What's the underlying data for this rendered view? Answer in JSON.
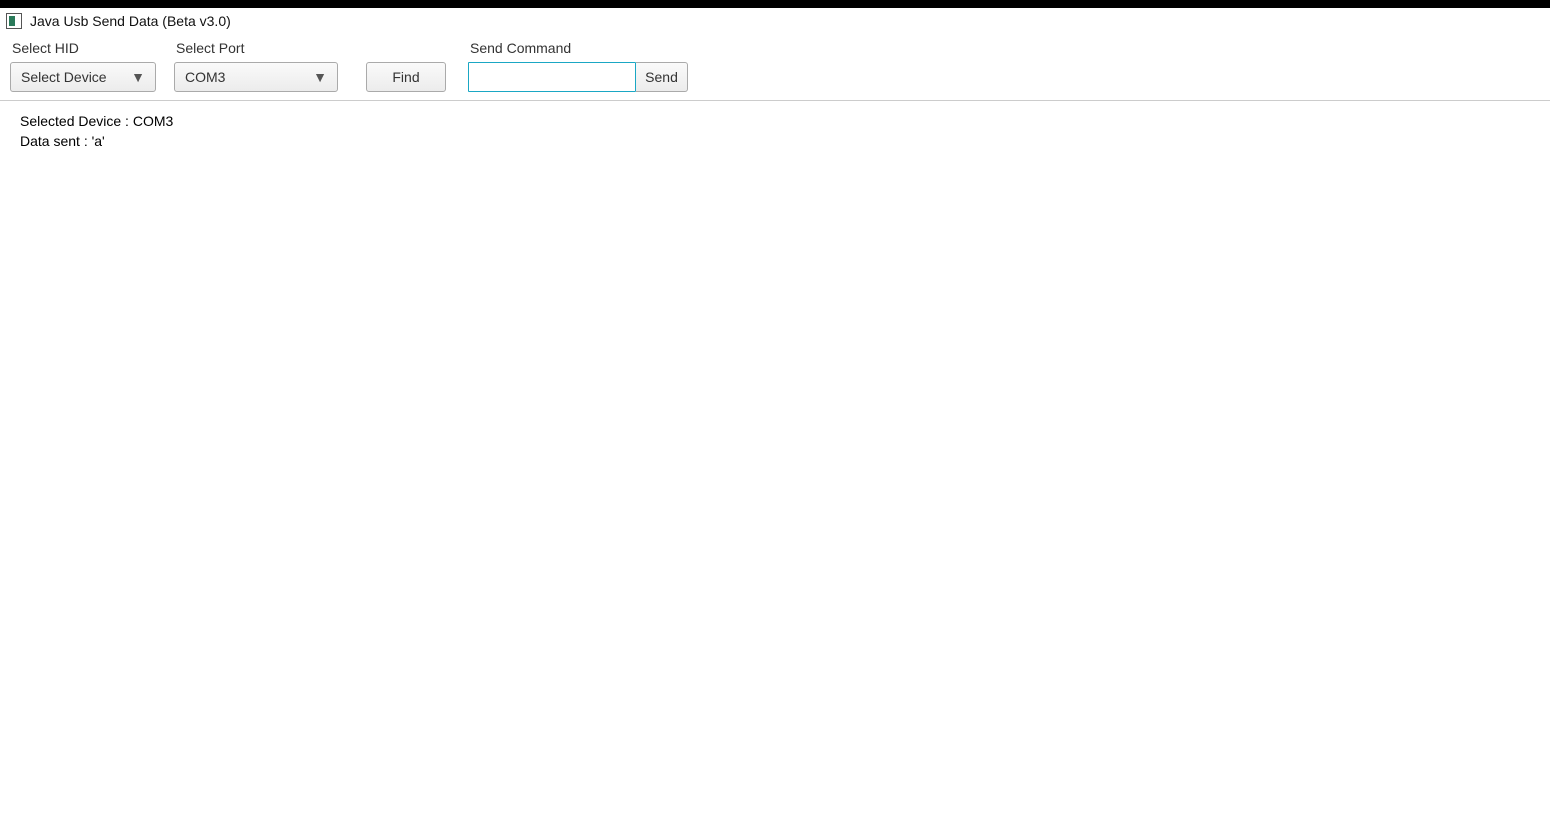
{
  "window": {
    "title": "Java Usb Send Data (Beta v3.0)"
  },
  "toolbar": {
    "select_hid_label": "Select HID",
    "select_hid_value": "Select Device",
    "select_port_label": "Select Port",
    "select_port_value": "COM3",
    "find_label": "Find",
    "send_command_label": "Send Command",
    "command_value": "",
    "send_label": "Send"
  },
  "output": {
    "line1": "Selected Device : COM3",
    "line2": "Data sent : 'a'"
  }
}
